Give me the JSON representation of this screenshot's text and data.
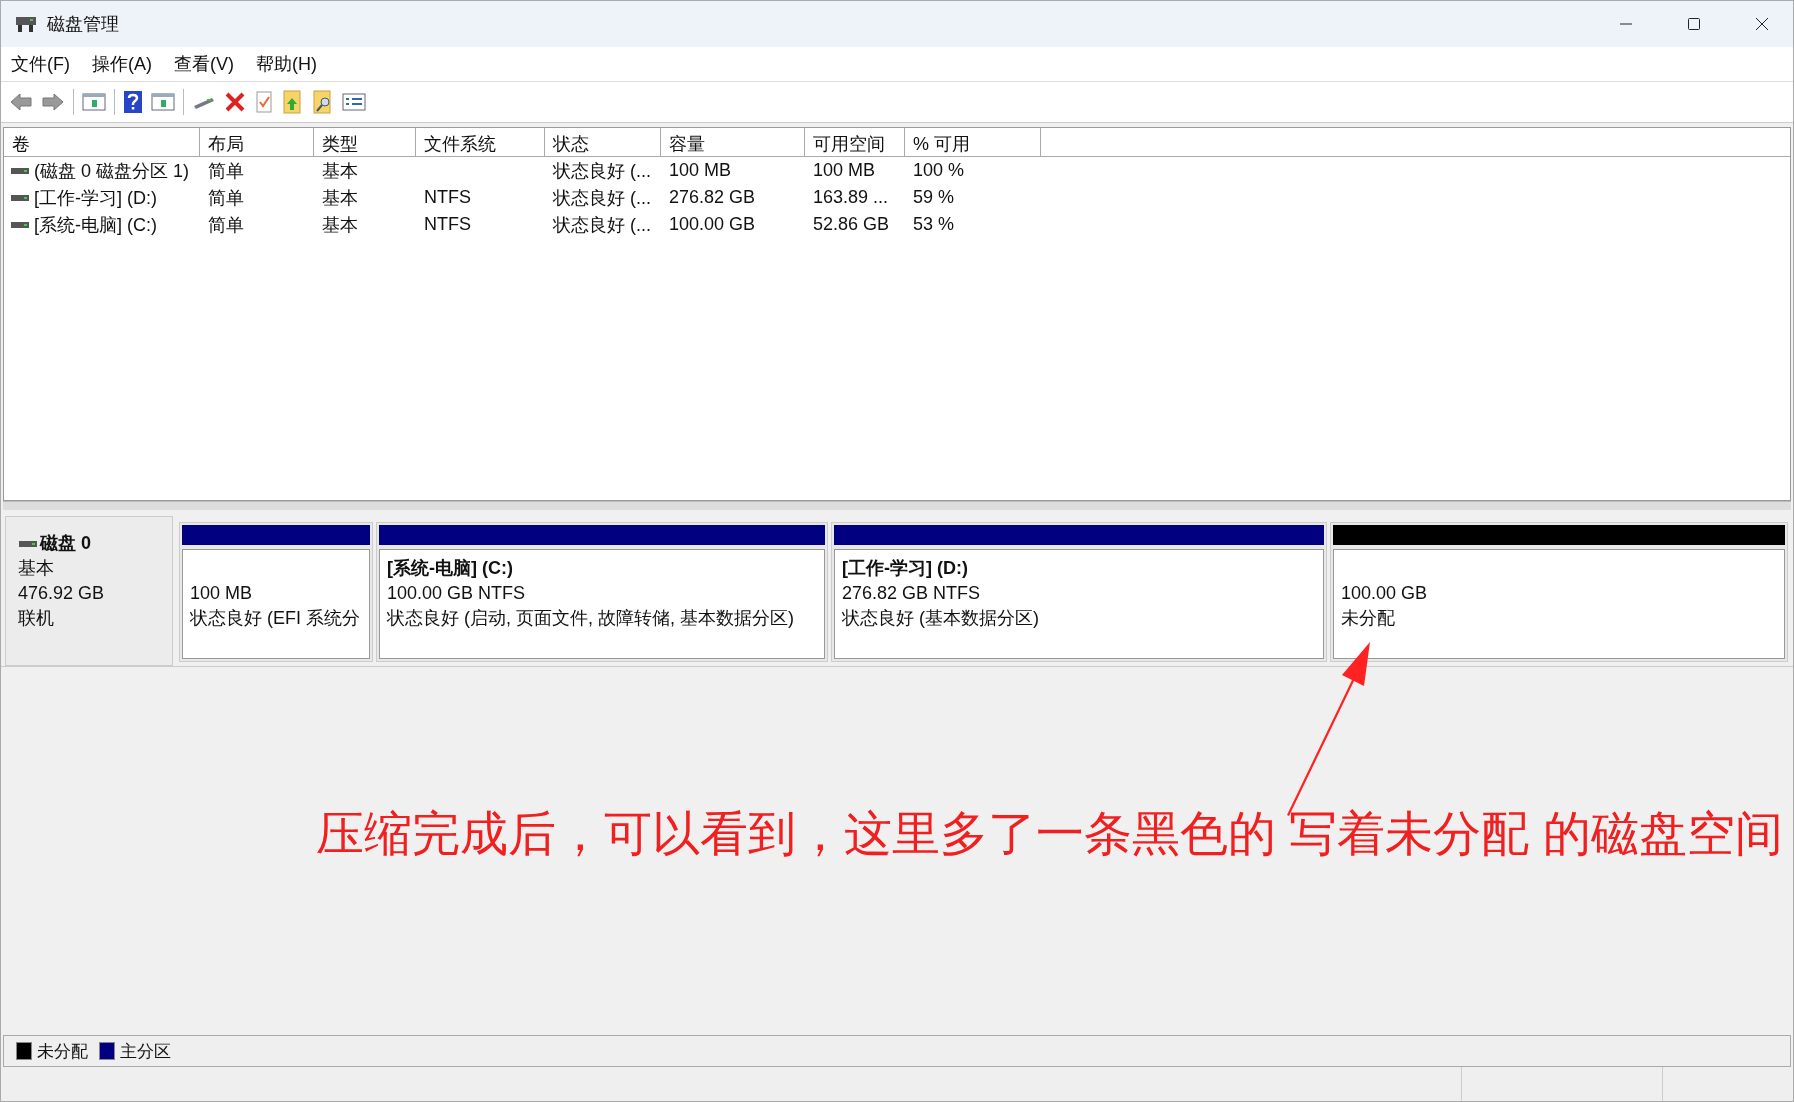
{
  "window": {
    "title": "磁盘管理"
  },
  "menu": [
    "文件(F)",
    "操作(A)",
    "查看(V)",
    "帮助(H)"
  ],
  "table": {
    "columns": [
      "卷",
      "布局",
      "类型",
      "文件系统",
      "状态",
      "容量",
      "可用空间",
      "% 可用"
    ],
    "rows": [
      [
        "(磁盘 0 磁盘分区 1)",
        "简单",
        "基本",
        "",
        "状态良好 (...",
        "100 MB",
        "100 MB",
        "100 %"
      ],
      [
        "[工作-学习] (D:)",
        "简单",
        "基本",
        "NTFS",
        "状态良好 (...",
        "276.82 GB",
        "163.89 ...",
        "59 %"
      ],
      [
        "[系统-电脑] (C:)",
        "简单",
        "基本",
        "NTFS",
        "状态良好 (...",
        "100.00 GB",
        "52.86 GB",
        "53 %"
      ]
    ]
  },
  "disk": {
    "name": "磁盘 0",
    "type": "基本",
    "size": "476.92 GB",
    "status": "联机",
    "partitions": [
      {
        "size": "100 MB",
        "status": "状态良好 (EFI 系统分",
        "color": "#000080"
      },
      {
        "name": "[系统-电脑]  (C:)",
        "size": "100.00 GB NTFS",
        "status": "状态良好 (启动, 页面文件, 故障转储, 基本数据分区)",
        "color": "#000080"
      },
      {
        "name": "[工作-学习]  (D:)",
        "size": "276.82 GB NTFS",
        "status": "状态良好 (基本数据分区)",
        "color": "#000080"
      },
      {
        "size": "100.00 GB",
        "status": "未分配",
        "color": "#000000"
      }
    ]
  },
  "annotation": "压缩完成后，可以看到，这里多了一条黑色的 写着未分配 的磁盘空间",
  "legend": [
    {
      "label": "未分配",
      "color": "#000000"
    },
    {
      "label": "主分区",
      "color": "#000080"
    }
  ]
}
